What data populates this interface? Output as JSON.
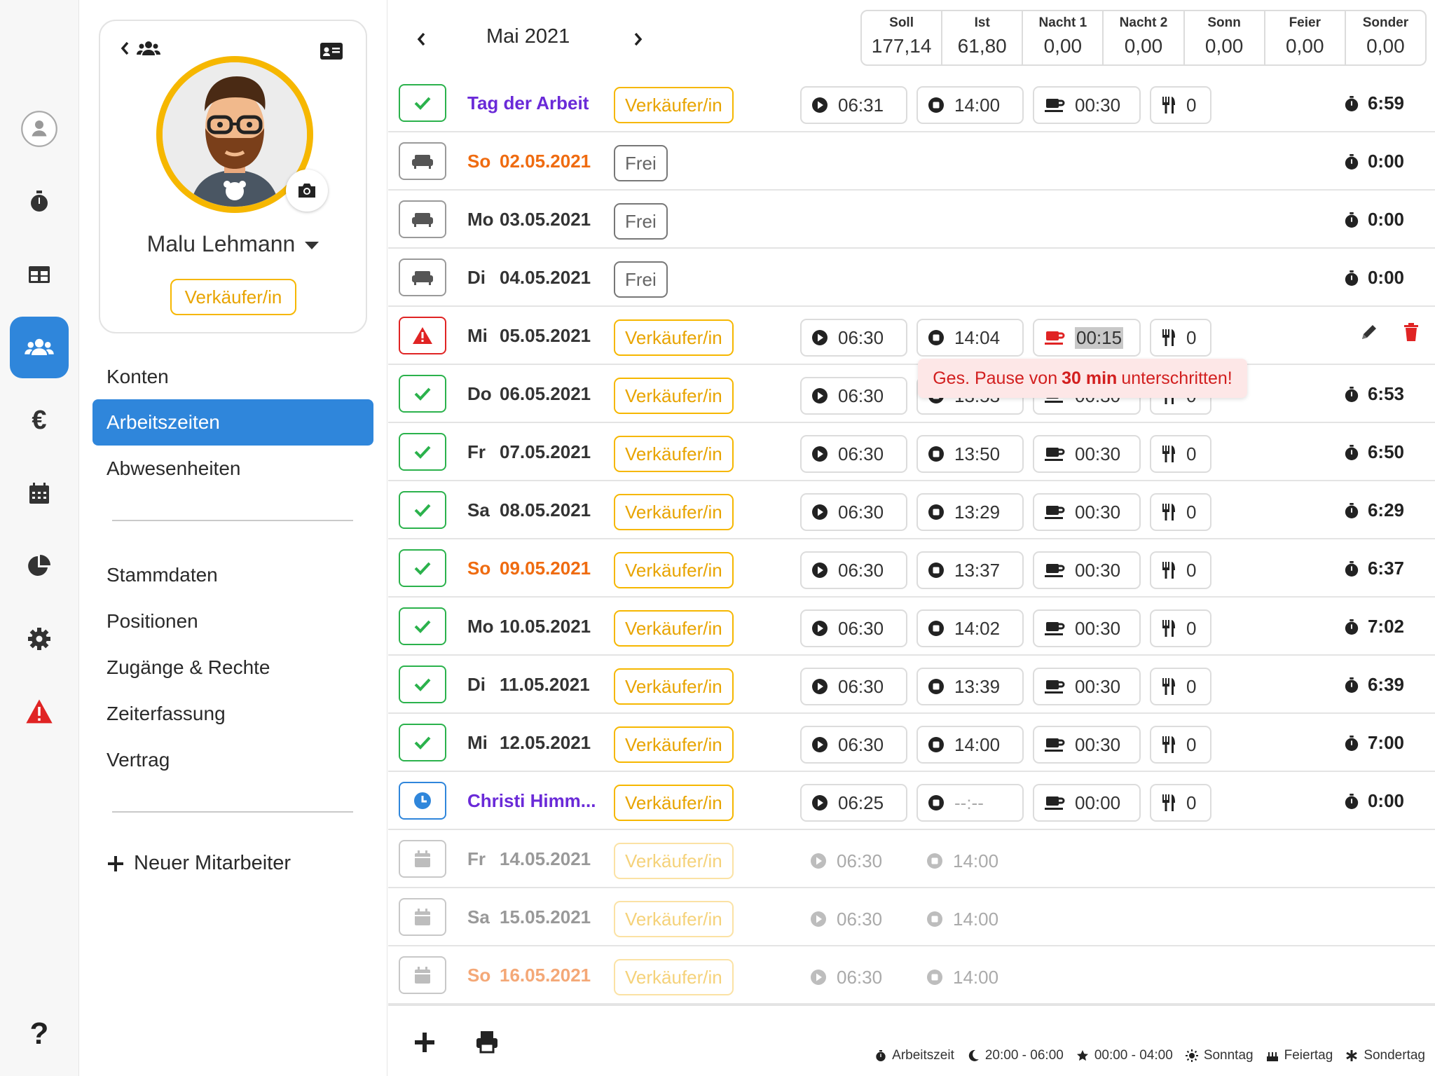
{
  "profile": {
    "name": "Malu Lehmann",
    "role": "Verkäufer/in"
  },
  "menu": {
    "items": [
      "Konten",
      "Arbeitszeiten",
      "Abwesenheiten"
    ],
    "items2": [
      "Stammdaten",
      "Positionen",
      "Zugänge & Rechte",
      "Zeiterfassung",
      "Vertrag"
    ],
    "new_employee": "Neuer Mitarbeiter"
  },
  "header": {
    "month": "Mai 2021",
    "totals": [
      {
        "label": "Soll",
        "value": "177,14"
      },
      {
        "label": "Ist",
        "value": "61,80"
      },
      {
        "label": "Nacht 1",
        "value": "0,00"
      },
      {
        "label": "Nacht 2",
        "value": "0,00"
      },
      {
        "label": "Sonn",
        "value": "0,00"
      },
      {
        "label": "Feier",
        "value": "0,00"
      },
      {
        "label": "Sonder",
        "value": "0,00"
      }
    ]
  },
  "rows": [
    {
      "status": "ok",
      "day": "",
      "date": "Tag der Arbeit",
      "kind": "holiday",
      "pos": "Verkäufer/in",
      "start": "06:31",
      "end": "14:00",
      "brk": "00:30",
      "meal": "0",
      "dur": "6:59"
    },
    {
      "status": "free",
      "day": "So",
      "date": "02.05.2021",
      "kind": "sunday",
      "pos": "Frei",
      "dur": "0:00"
    },
    {
      "status": "free",
      "day": "Mo",
      "date": "03.05.2021",
      "kind": "normal",
      "pos": "Frei",
      "dur": "0:00"
    },
    {
      "status": "free",
      "day": "Di",
      "date": "04.05.2021",
      "kind": "normal",
      "pos": "Frei",
      "dur": "0:00"
    },
    {
      "status": "warn",
      "day": "Mi",
      "date": "05.05.2021",
      "kind": "normal",
      "pos": "Verkäufer/in",
      "start": "06:30",
      "end": "14:04",
      "brk": "00:15",
      "meal": "0",
      "dur": ""
    },
    {
      "status": "ok",
      "day": "Do",
      "date": "06.05.2021",
      "kind": "normal",
      "pos": "Verkäufer/in",
      "start": "06:30",
      "end": "13:53",
      "brk": "00:30",
      "meal": "0",
      "dur": "6:53"
    },
    {
      "status": "ok",
      "day": "Fr",
      "date": "07.05.2021",
      "kind": "normal",
      "pos": "Verkäufer/in",
      "start": "06:30",
      "end": "13:50",
      "brk": "00:30",
      "meal": "0",
      "dur": "6:50"
    },
    {
      "status": "ok",
      "day": "Sa",
      "date": "08.05.2021",
      "kind": "normal",
      "pos": "Verkäufer/in",
      "start": "06:30",
      "end": "13:29",
      "brk": "00:30",
      "meal": "0",
      "dur": "6:29"
    },
    {
      "status": "ok",
      "day": "So",
      "date": "09.05.2021",
      "kind": "sunday",
      "pos": "Verkäufer/in",
      "start": "06:30",
      "end": "13:37",
      "brk": "00:30",
      "meal": "0",
      "dur": "6:37"
    },
    {
      "status": "ok",
      "day": "Mo",
      "date": "10.05.2021",
      "kind": "normal",
      "pos": "Verkäufer/in",
      "start": "06:30",
      "end": "14:02",
      "brk": "00:30",
      "meal": "0",
      "dur": "7:02"
    },
    {
      "status": "ok",
      "day": "Di",
      "date": "11.05.2021",
      "kind": "normal",
      "pos": "Verkäufer/in",
      "start": "06:30",
      "end": "13:39",
      "brk": "00:30",
      "meal": "0",
      "dur": "6:39"
    },
    {
      "status": "ok",
      "day": "Mi",
      "date": "12.05.2021",
      "kind": "normal",
      "pos": "Verkäufer/in",
      "start": "06:30",
      "end": "14:00",
      "brk": "00:30",
      "meal": "0",
      "dur": "7:00"
    },
    {
      "status": "clock",
      "day": "",
      "date": "Christi Himm...",
      "kind": "holiday",
      "pos": "Verkäufer/in",
      "start": "06:25",
      "end": "--:--",
      "brk": "00:00",
      "meal": "0",
      "dur": "0:00"
    },
    {
      "status": "future",
      "day": "Fr",
      "date": "14.05.2021",
      "kind": "future",
      "pos": "Verkäufer/in",
      "start": "06:30",
      "end": "14:00"
    },
    {
      "status": "future",
      "day": "Sa",
      "date": "15.05.2021",
      "kind": "future",
      "pos": "Verkäufer/in",
      "start": "06:30",
      "end": "14:00"
    },
    {
      "status": "future",
      "day": "So",
      "date": "16.05.2021",
      "kind": "future-sun",
      "pos": "Verkäufer/in",
      "start": "06:30",
      "end": "14:00"
    }
  ],
  "tooltip": {
    "pre": "Ges. Pause von ",
    "bold": "30 min",
    "post": " unterschritten!"
  },
  "legend": [
    {
      "icon": "stopwatch-icon",
      "label": "Arbeitszeit"
    },
    {
      "icon": "moon-icon",
      "label": "20:00 - 06:00"
    },
    {
      "icon": "star-icon",
      "label": "00:00 - 04:00"
    },
    {
      "icon": "sun-icon",
      "label": "Sonntag"
    },
    {
      "icon": "cake-icon",
      "label": "Feiertag"
    },
    {
      "icon": "asterisk-icon",
      "label": "Sondertag"
    }
  ],
  "colors": {
    "accent": "#2f86db",
    "position": "#f6b700",
    "ok": "#2bb24c",
    "warn": "#e02424",
    "holiday": "#6a2ad8",
    "sunday": "#ef6b10"
  }
}
